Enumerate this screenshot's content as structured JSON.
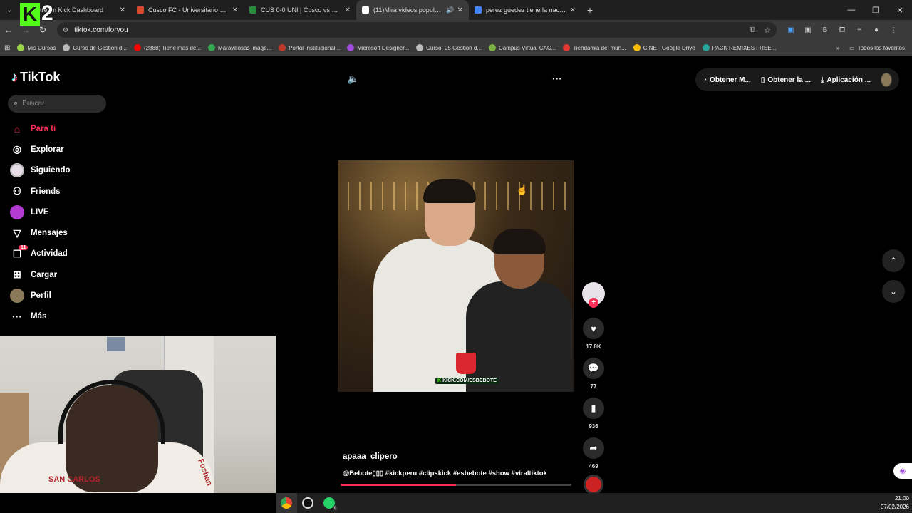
{
  "browser": {
    "tabs": [
      {
        "title": "Stream Kick Dashboard",
        "color": "#53fc18",
        "active": false,
        "audio": false
      },
      {
        "title": "Cusco FC - Universitario de Dep",
        "color": "#d84a2a",
        "active": false,
        "audio": false
      },
      {
        "title": "CUS 0-0 UNI | Cusco vs Univers",
        "color": "#2b8a3e",
        "active": false,
        "audio": false
      },
      {
        "title": "(11)Mira videos populares",
        "color": "#ffffff",
        "active": true,
        "audio": true
      },
      {
        "title": "perez guedez tiene la nacionali",
        "color": "#4285f4",
        "active": false,
        "audio": false
      }
    ],
    "new_tab": "+",
    "url": "tiktok.com/foryou",
    "bookmarks": [
      {
        "label": "Mis Cursos",
        "color": "#9bd84a"
      },
      {
        "label": "Curso de Gestión d...",
        "color": "#bbbbbb"
      },
      {
        "label": "(2888) Tiene más de...",
        "color": "#ff0000"
      },
      {
        "label": "Maravillosas imáge...",
        "color": "#34a853"
      },
      {
        "label": "Portal Institucional...",
        "color": "#c0392b"
      },
      {
        "label": "Microsoft Designer...",
        "color": "#a34be0"
      },
      {
        "label": "Curso: 05 Gestión d...",
        "color": "#bbbbbb"
      },
      {
        "label": "Campus Virtual CAC...",
        "color": "#7cb342"
      },
      {
        "label": "Tiendamia del mun...",
        "color": "#e53935"
      },
      {
        "label": "CINE - Google Drive",
        "color": "#fbbc04"
      },
      {
        "label": "PACK REMIXES FREE...",
        "color": "#26a69a"
      }
    ],
    "all_bookmarks": "Todos los favoritos"
  },
  "tiktok": {
    "logo": "TikTok",
    "search_placeholder": "Buscar",
    "nav": [
      {
        "label": "Para ti",
        "icon": "home-icon",
        "glyph": "⌂",
        "active": true
      },
      {
        "label": "Explorar",
        "icon": "compass-icon",
        "glyph": "◎",
        "active": false
      },
      {
        "label": "Siguiendo",
        "icon": "following-avatar-icon",
        "glyph": "",
        "active": false
      },
      {
        "label": "Friends",
        "icon": "friends-icon",
        "glyph": "⚇",
        "active": false
      },
      {
        "label": "LIVE",
        "icon": "live-icon",
        "glyph": "",
        "active": false
      },
      {
        "label": "Mensajes",
        "icon": "send-icon",
        "glyph": "▽",
        "active": false
      },
      {
        "label": "Actividad",
        "icon": "activity-icon",
        "glyph": "☐",
        "active": false,
        "badge": "11"
      },
      {
        "label": "Cargar",
        "icon": "upload-icon",
        "glyph": "⊞",
        "active": false
      },
      {
        "label": "Perfil",
        "icon": "profile-avatar-icon",
        "glyph": "",
        "active": false
      },
      {
        "label": "Más",
        "icon": "more-icon",
        "glyph": "···",
        "active": false
      }
    ],
    "top_actions": [
      {
        "label": "Obtener M...",
        "icon": "coins-icon",
        "glyph": "◔"
      },
      {
        "label": "Obtener la ...",
        "icon": "phone-icon",
        "glyph": "▯"
      },
      {
        "label": "Aplicación ...",
        "icon": "download-icon",
        "glyph": "⤓"
      }
    ],
    "video": {
      "watermark": "KICK.COM/ESBEBOTE",
      "author": "apaaa_clipero",
      "caption": "@Bebote▯▯▯ #kickperu #clipskick #esbebote #show #viraltiktok",
      "progress": 0.5
    },
    "actions": {
      "likes": "17.8K",
      "comments": "77",
      "saves": "936",
      "shares": "469"
    }
  },
  "webcam": {
    "shirt_text": "SAN CARLOS",
    "shirt_text2": "Foshan"
  },
  "taskbar": {
    "time": "21:00",
    "date": "07/02/2026",
    "whatsapp_badge": "9"
  },
  "overlay_logo": "2"
}
